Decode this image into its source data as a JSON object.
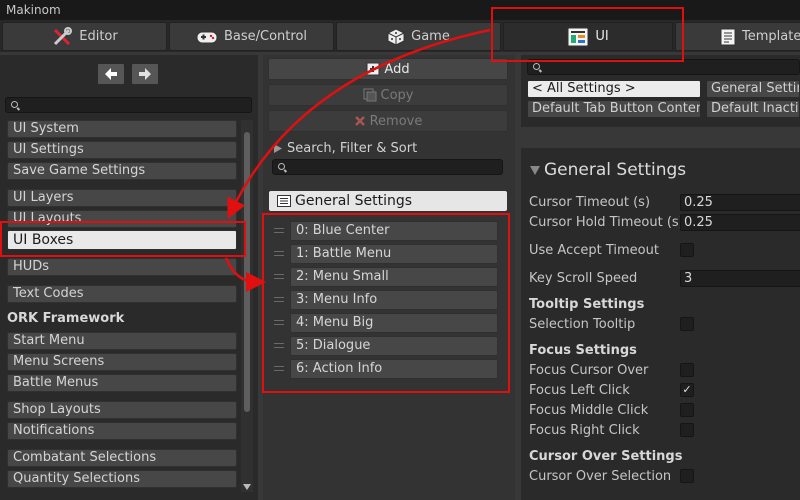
{
  "app": {
    "title": "Makinom"
  },
  "tabs": [
    {
      "label": "Editor",
      "icon": "tools-icon"
    },
    {
      "label": "Base/Control",
      "icon": "gamepad-icon"
    },
    {
      "label": "Game",
      "icon": "dice-icon"
    },
    {
      "label": "UI",
      "icon": "ui-icon"
    },
    {
      "label": "Templates",
      "icon": "template-icon"
    }
  ],
  "left": {
    "items": [
      "UI System",
      "UI Settings",
      "Save Game Settings",
      "UI Layers",
      "UI Layouts",
      "UI Boxes",
      "HUDs",
      "Text Codes",
      "Start Menu",
      "Menu Screens",
      "Battle Menus",
      "Shop Layouts",
      "Notifications",
      "Combatant Selections",
      "Quantity Selections"
    ],
    "group_header": "ORK Framework",
    "selected": "UI Boxes"
  },
  "middle": {
    "add": "Add",
    "copy": "Copy",
    "remove": "Remove",
    "filter_label": "Search, Filter & Sort",
    "section_title": "General Settings",
    "items": [
      "0: Blue Center",
      "1: Battle Menu",
      "2: Menu Small",
      "3: Menu Info",
      "4: Menu Big",
      "5: Dialogue",
      "6: Action Info"
    ]
  },
  "right": {
    "tabs": [
      "< All Settings >",
      "General Settings",
      "Default Tab Button Content",
      "Default Inactive"
    ],
    "section_title": "General Settings",
    "fields": {
      "cursor_timeout": {
        "label": "Cursor Timeout (s)",
        "value": "0.25"
      },
      "cursor_hold_timeout": {
        "label": "Cursor Hold Timeout (s)",
        "value": "0.25"
      },
      "use_accept_timeout": {
        "label": "Use Accept Timeout",
        "checked": false
      },
      "key_scroll_speed": {
        "label": "Key Scroll Speed",
        "value": "3"
      }
    },
    "tooltip_header": "Tooltip Settings",
    "selection_tooltip": {
      "label": "Selection Tooltip",
      "checked": false
    },
    "focus_header": "Focus Settings",
    "focus_cursor_over": {
      "label": "Focus Cursor Over",
      "checked": false
    },
    "focus_left_click": {
      "label": "Focus Left Click",
      "checked": true
    },
    "focus_middle_click": {
      "label": "Focus Middle Click",
      "checked": false
    },
    "focus_right_click": {
      "label": "Focus Right Click",
      "checked": false
    },
    "cursor_over_header": "Cursor Over Settings",
    "cursor_over_selection": {
      "label": "Cursor Over Selection",
      "checked": false
    },
    "check_glyph": "✓"
  },
  "colors": {
    "highlight": "#e01010",
    "panel": "#2a2a2a",
    "selected_item": "#e9e9e9"
  }
}
